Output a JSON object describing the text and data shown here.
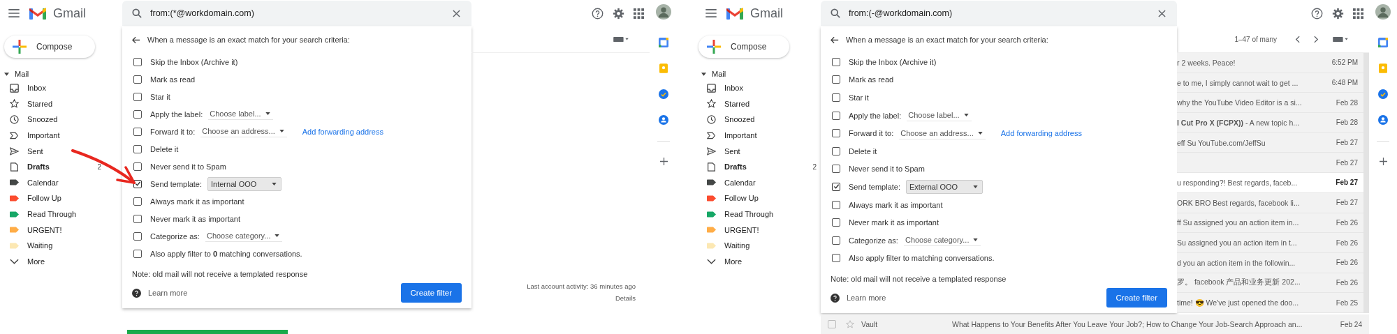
{
  "panels": [
    {
      "logo": "Gmail",
      "search": {
        "value": "from:(*@workdomain.com)"
      },
      "sidebar": {
        "compose": "Compose",
        "section": "Mail",
        "items": [
          {
            "label": "Inbox",
            "kind": "inbox",
            "bold": false
          },
          {
            "label": "Starred",
            "kind": "star",
            "bold": false
          },
          {
            "label": "Snoozed",
            "kind": "clock",
            "bold": false
          },
          {
            "label": "Important",
            "kind": "important",
            "bold": false
          },
          {
            "label": "Sent",
            "kind": "sent",
            "bold": false
          },
          {
            "label": "Drafts",
            "kind": "draft",
            "bold": true,
            "count": "2"
          },
          {
            "label": "Calendar",
            "kind": "label",
            "bold": false,
            "color": "#444746"
          },
          {
            "label": "Follow Up",
            "kind": "label",
            "bold": false,
            "color": "#fb4c2f"
          },
          {
            "label": "Read Through",
            "kind": "label",
            "bold": false,
            "color": "#16a766"
          },
          {
            "label": "URGENT!",
            "kind": "label",
            "bold": false,
            "color": "#ffad47"
          },
          {
            "label": "Waiting",
            "kind": "label",
            "bold": false,
            "color": "#fce8b3"
          },
          {
            "label": "More",
            "kind": "more",
            "bold": false
          }
        ]
      },
      "dialog": {
        "heading": "When a message is an exact match for your search criteria:",
        "options": [
          {
            "kind": "plain",
            "label": "Skip the Inbox (Archive it)",
            "checked": false
          },
          {
            "kind": "plain",
            "label": "Mark as read",
            "checked": false
          },
          {
            "kind": "plain",
            "label": "Star it",
            "checked": false
          },
          {
            "kind": "select",
            "label": "Apply the label:",
            "select": "Choose label...",
            "checked": false
          },
          {
            "kind": "select",
            "label": "Forward it to:",
            "select": "Choose an address...",
            "link": "Add forwarding address",
            "checked": false
          },
          {
            "kind": "plain",
            "label": "Delete it",
            "checked": false
          },
          {
            "kind": "plain",
            "label": "Never send it to Spam",
            "checked": false
          },
          {
            "kind": "template",
            "label": "Send template:",
            "select": "Internal OOO",
            "checked": true
          },
          {
            "kind": "plain",
            "label": "Always mark it as important",
            "checked": false
          },
          {
            "kind": "plain",
            "label": "Never mark it as important",
            "checked": false
          },
          {
            "kind": "select",
            "label": "Categorize as:",
            "select": "Choose category...",
            "checked": false
          },
          {
            "kind": "plain",
            "label": "Also apply filter to **0** matching conversations.",
            "checked": false
          }
        ],
        "note": "Note: old mail will not receive a templated response",
        "learn_more": "Learn more",
        "button": "Create filter"
      },
      "activity": {
        "text": "Last account activity: 36 minutes ago",
        "details": "Details"
      },
      "loading_bar": true
    },
    {
      "logo": "Gmail",
      "search": {
        "value": "from:(-@workdomain.com)"
      },
      "sidebar": {
        "compose": "Compose",
        "section": "Mail",
        "items": [
          {
            "label": "Inbox",
            "kind": "inbox",
            "bold": false
          },
          {
            "label": "Starred",
            "kind": "star",
            "bold": false
          },
          {
            "label": "Snoozed",
            "kind": "clock",
            "bold": false
          },
          {
            "label": "Important",
            "kind": "important",
            "bold": false
          },
          {
            "label": "Sent",
            "kind": "sent",
            "bold": false
          },
          {
            "label": "Drafts",
            "kind": "draft",
            "bold": true,
            "count": "2"
          },
          {
            "label": "Calendar",
            "kind": "label",
            "bold": false,
            "color": "#444746"
          },
          {
            "label": "Follow Up",
            "kind": "label",
            "bold": false,
            "color": "#fb4c2f"
          },
          {
            "label": "Read Through",
            "kind": "label",
            "bold": false,
            "color": "#16a766"
          },
          {
            "label": "URGENT!",
            "kind": "label",
            "bold": false,
            "color": "#ffad47"
          },
          {
            "label": "Waiting",
            "kind": "label",
            "bold": false,
            "color": "#fce8b3"
          },
          {
            "label": "More",
            "kind": "more",
            "bold": false
          }
        ]
      },
      "dialog": {
        "heading": "When a message is an exact match for your search criteria:",
        "options": [
          {
            "kind": "plain",
            "label": "Skip the Inbox (Archive it)",
            "checked": false
          },
          {
            "kind": "plain",
            "label": "Mark as read",
            "checked": false
          },
          {
            "kind": "plain",
            "label": "Star it",
            "checked": false
          },
          {
            "kind": "select",
            "label": "Apply the label:",
            "select": "Choose label...",
            "checked": false
          },
          {
            "kind": "select",
            "label": "Forward it to:",
            "select": "Choose an address...",
            "link": "Add forwarding address",
            "checked": false
          },
          {
            "kind": "plain",
            "label": "Delete it",
            "checked": false
          },
          {
            "kind": "plain",
            "label": "Never send it to Spam",
            "checked": false
          },
          {
            "kind": "template",
            "label": "Send template:",
            "select": "External OOO",
            "checked": true
          },
          {
            "kind": "plain",
            "label": "Always mark it as important",
            "checked": false
          },
          {
            "kind": "plain",
            "label": "Never mark it as important",
            "checked": false
          },
          {
            "kind": "select",
            "label": "Categorize as:",
            "select": "Choose category...",
            "checked": false
          },
          {
            "kind": "plain",
            "label": "Also apply filter to matching conversations.",
            "checked": false
          }
        ],
        "note": "Note: old mail will not receive a templated response",
        "learn_more": "Learn more",
        "button": "Create filter"
      },
      "pager": "1–47 of many",
      "emails": [
        {
          "snippet": "r 2 weeks. Peace!",
          "date": "6:52 PM",
          "unread": false
        },
        {
          "snippet": "e to me, I simply cannot wait to get ...",
          "date": "6:48 PM",
          "unread": false
        },
        {
          "snippet": "why the YouTube Video Editor is a si...",
          "date": "Feb 28",
          "unread": false
        },
        {
          "snippet": "**l Cut Pro X (FCPX))** - A new topic h...",
          "date": "Feb 28",
          "unread": false
        },
        {
          "snippet": "eff Su YouTube.com/JeffSu",
          "date": "Feb 27",
          "unread": false
        },
        {
          "date": "Feb 27",
          "unread": false
        },
        {
          "snippet": "u responding?! Best regards, faceb...",
          "date": "Feb 27",
          "unread": true
        },
        {
          "snippet": "ORK BRO Best regards, facebook li...",
          "date": "Feb 27",
          "unread": false
        },
        {
          "snippet": "ff Su assigned you an action item in...",
          "date": "Feb 26",
          "unread": false
        },
        {
          "snippet": "Su assigned you an action item in t...",
          "date": "Feb 26",
          "unread": false
        },
        {
          "snippet": "d you an action item in the followin...",
          "date": "Feb 26",
          "unread": false
        },
        {
          "snippet": "罗。 facebook 产品和业务更新 202...",
          "date": "Feb 26",
          "unread": false
        },
        {
          "snippet": "time! 😎 We've just opened the doo...",
          "date": "Feb 25",
          "unread": false
        }
      ],
      "footer_email": {
        "checked": false,
        "sender": "Vault",
        "subject": "What Happens to Your Benefits After You Leave Your Job?; How to Change Your Job-Search Approach an...",
        "date": "Feb 24"
      }
    }
  ],
  "annotation": {
    "kind": "arrow"
  }
}
